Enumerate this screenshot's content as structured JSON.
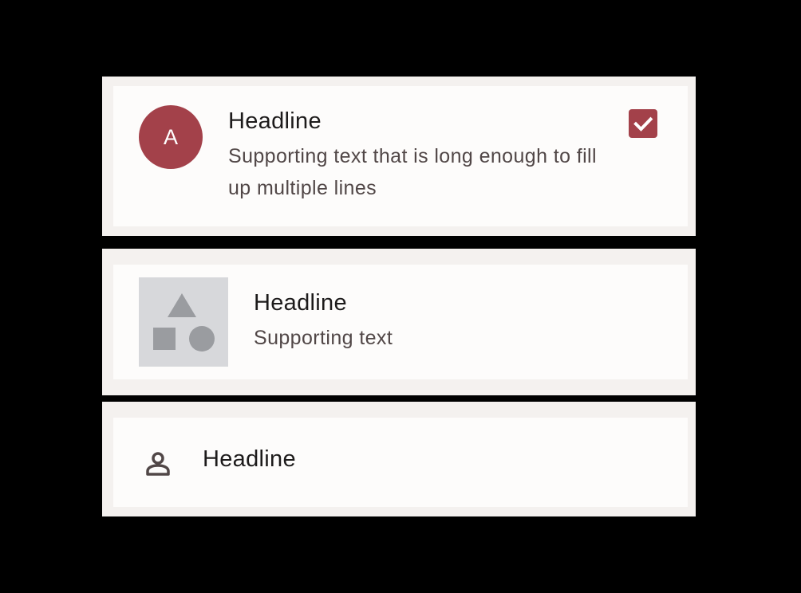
{
  "list": {
    "item_1": {
      "avatar_letter": "A",
      "headline": "Headline",
      "supporting_text": "Supporting text that is long enough to fill up multiple lines",
      "checkbox_checked": true,
      "checkbox_icon": "check-icon"
    },
    "item_2": {
      "thumbnail_icon": "shapes-placeholder-icon",
      "headline": "Headline",
      "supporting_text": "Supporting text"
    },
    "item_3": {
      "leading_icon": "person-icon",
      "headline": "Headline"
    }
  },
  "colors": {
    "accent": "#a3414a",
    "surface": "#fdfcfb",
    "outline_surface": "#f4f1ef",
    "headline_text": "#1d1b1b",
    "supporting_text": "#514747",
    "placeholder_bg": "#d7d8db",
    "placeholder_shape": "#9a9ca0"
  }
}
